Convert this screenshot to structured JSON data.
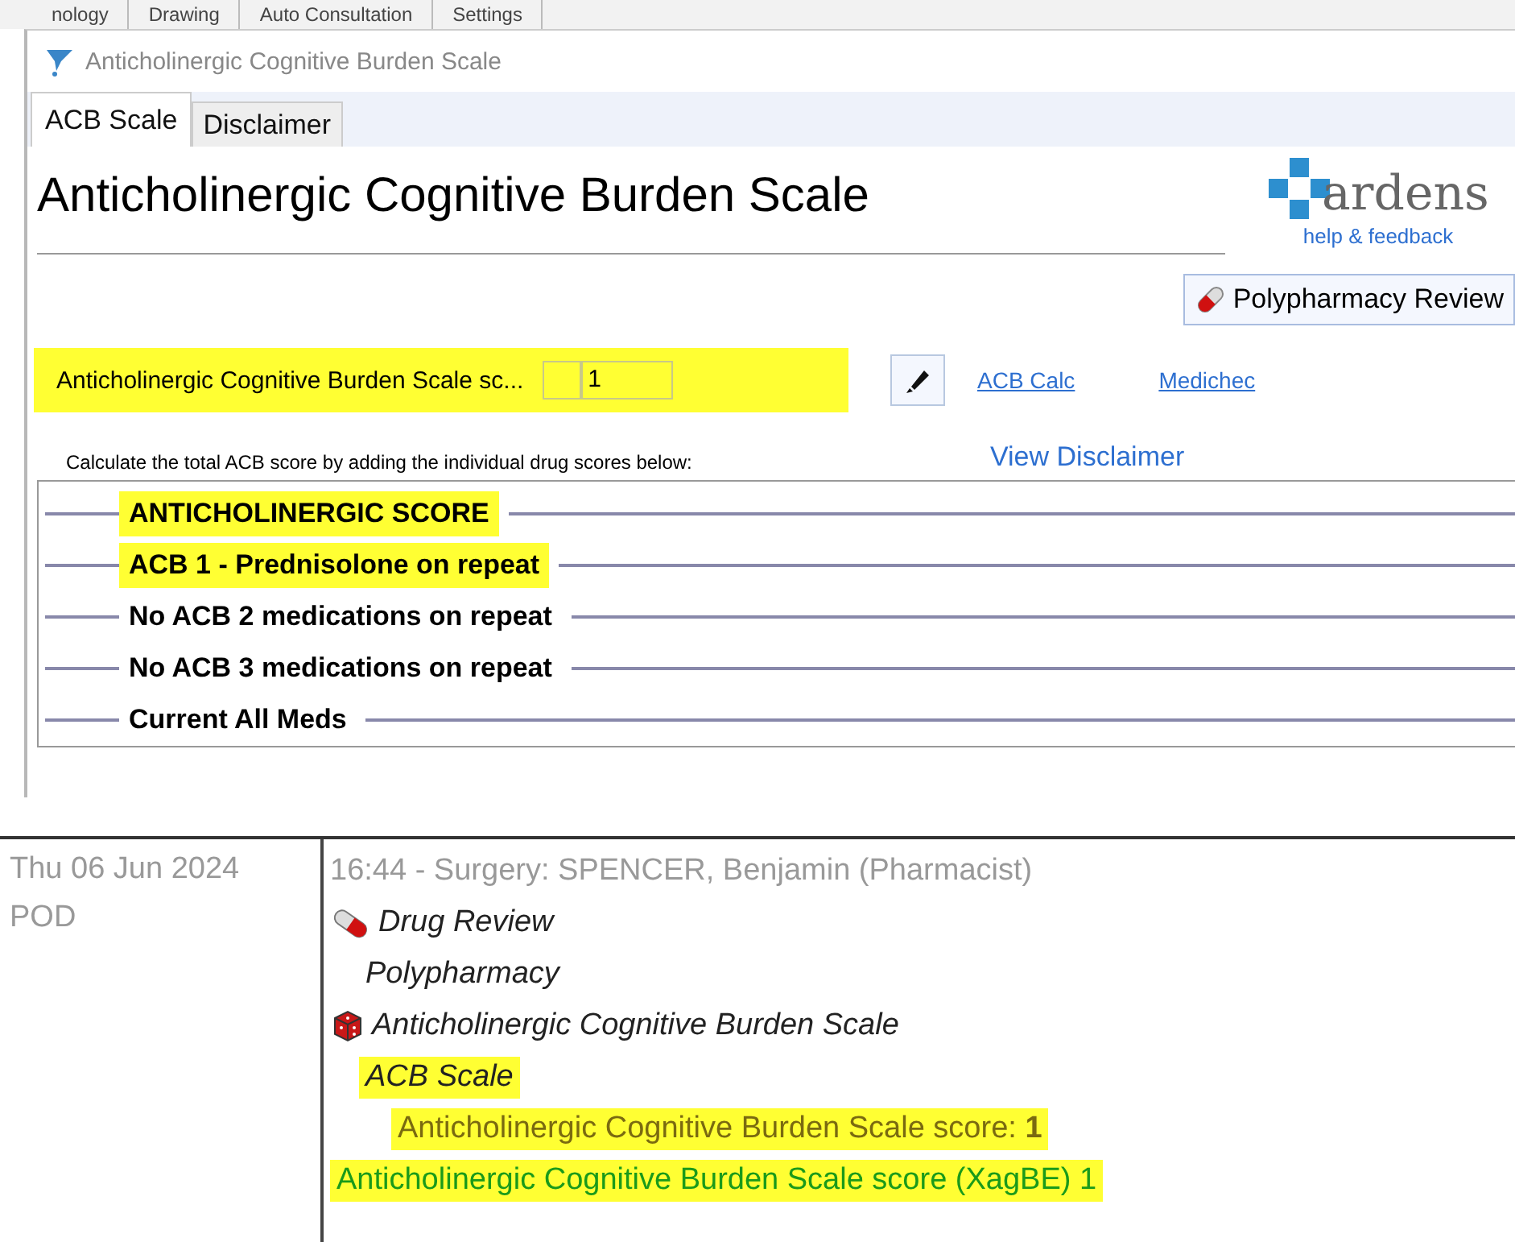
{
  "background_tabs": [
    {
      "label": "nology"
    },
    {
      "label": "Drawing"
    },
    {
      "label": "Auto Consultation"
    },
    {
      "label": "Settings"
    }
  ],
  "window": {
    "title": "Anticholinergic Cognitive Burden Scale"
  },
  "tabs": [
    {
      "label": "ACB Scale",
      "selected": true
    },
    {
      "label": "Disclaimer",
      "selected": false
    }
  ],
  "heading": "Anticholinergic Cognitive Burden Scale",
  "logo": {
    "name": "ardens",
    "link": "help & feedback"
  },
  "review_button": "Polypharmacy Review",
  "score": {
    "label": "Anticholinergic Cognitive Burden Scale sc...",
    "value": "1",
    "highlighted": true
  },
  "links": [
    "ACB Calc",
    "Medichec"
  ],
  "instruction": "Calculate the total ACB score by adding the individual drug scores below:",
  "disclaimer_link": "View Disclaimer",
  "sections": [
    {
      "title": "ANTICHOLINERGIC SCORE",
      "highlighted": true
    },
    {
      "title": "ACB 1 - Prednisolone on repeat",
      "highlighted": true
    },
    {
      "title": "No ACB 2 medications on repeat",
      "highlighted": false
    },
    {
      "title": "No ACB 3 medications on repeat",
      "highlighted": false
    },
    {
      "title": "Current All Meds",
      "highlighted": false
    }
  ],
  "journal": {
    "date": "Thu 06 Jun 2024",
    "location": "POD",
    "header": "16:44 - Surgery: SPENCER, Benjamin (Pharmacist)",
    "entries": [
      {
        "kind": "drug",
        "text": "Drug Review",
        "highlighted": false
      },
      {
        "kind": "sub",
        "text": "Polypharmacy",
        "highlighted": false
      },
      {
        "kind": "scale",
        "text": "Anticholinergic Cognitive Burden Scale",
        "highlighted": false
      },
      {
        "kind": "sub",
        "text": "ACB Scale",
        "highlighted": true
      },
      {
        "kind": "value",
        "text": "Anticholinergic Cognitive Burden Scale score: **1**",
        "highlighted": true
      },
      {
        "kind": "code",
        "text": "Anticholinergic Cognitive Burden Scale score (XagBE) 1",
        "highlighted": true
      }
    ]
  }
}
